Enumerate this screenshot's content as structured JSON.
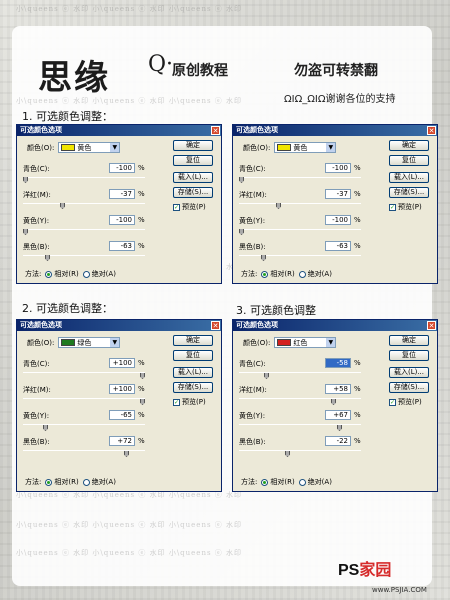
{
  "header": {
    "title_main": "思缘",
    "title_q": "Q·",
    "title_orig": "原创教程",
    "title_warn": "勿盗可转禁翻",
    "thanks": "ΩΙΩ_ΩΙΩ谢谢各位的支持"
  },
  "watermark": "小\\queens  ⓔ  水印    小\\queens  ⓔ  水印    小\\queens  ⓔ  水印",
  "steps": [
    "1. 可选颜色调整：",
    "2. 可选颜色调整：",
    "3. 可选颜色调整"
  ],
  "dialog_common": {
    "title": "可选颜色选项",
    "close": "✕",
    "color_label": "颜色(O):",
    "cyan_label": "青色(C):",
    "magenta_label": "洋红(M):",
    "yellow_label": "黄色(Y):",
    "black_label": "黑色(B):",
    "pct": "%",
    "ok": "确定",
    "reset": "复位",
    "load": "载入(L)...",
    "save": "存储(S)...",
    "preview": "预览(P)",
    "method": "方法:",
    "relative": "相对(R)",
    "absolute": "绝对(A)",
    "arrow": "▼"
  },
  "dialogs": [
    {
      "color_name": "黄色",
      "swatch": "#f2e600",
      "cyan": "-100",
      "magenta": "-37",
      "yellow": "-100",
      "black": "-63",
      "method": "relative"
    },
    {
      "color_name": "黄色",
      "swatch": "#f2e600",
      "cyan": "-100",
      "magenta": "-37",
      "yellow": "-100",
      "black": "-63",
      "method": "relative"
    },
    {
      "color_name": "绿色",
      "swatch": "#1f7a1f",
      "cyan": "+100",
      "magenta": "+100",
      "yellow": "-65",
      "black": "+72",
      "method": "relative"
    },
    {
      "color_name": "红色",
      "swatch": "#d42020",
      "cyan": "-58",
      "magenta": "+58",
      "yellow": "+67",
      "black": "-22",
      "method": "relative"
    }
  ],
  "logo": {
    "ps": "PS",
    "accent": "家园",
    "url": "www.PSJIA.COM"
  }
}
